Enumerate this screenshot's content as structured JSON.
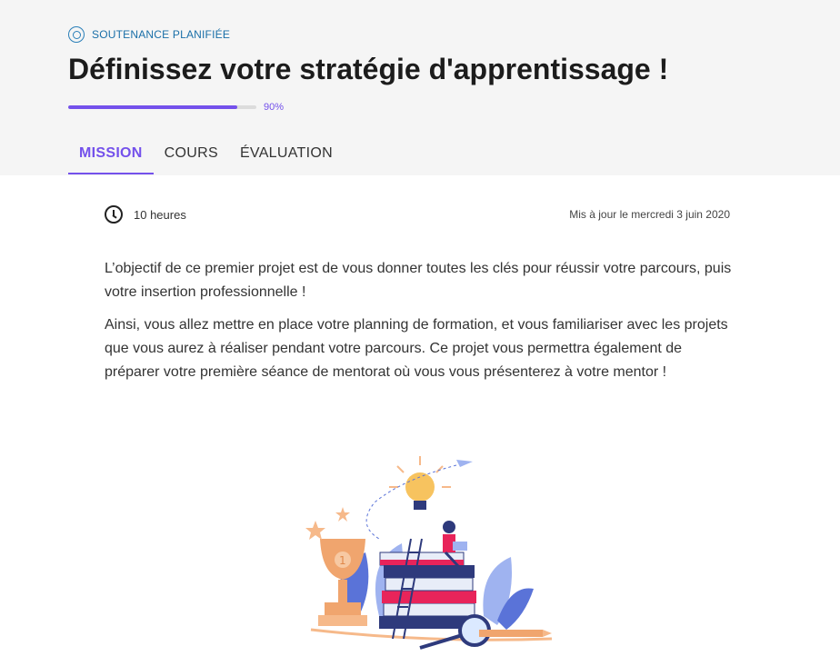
{
  "header": {
    "status_label": "SOUTENANCE PLANIFIÉE",
    "title": "Définissez votre stratégie d'apprentissage !",
    "progress": {
      "value": 0.9,
      "label": "90%"
    }
  },
  "tabs": [
    {
      "label": "MISSION",
      "active": true
    },
    {
      "label": "COURS",
      "active": false
    },
    {
      "label": "ÉVALUATION",
      "active": false
    }
  ],
  "meta": {
    "duration": "10 heures",
    "updated": "Mis à jour le mercredi 3 juin 2020"
  },
  "content": {
    "paragraphs": [
      "L’objectif de ce premier projet est de vous donner toutes les clés pour réussir votre parcours, puis votre insertion professionnelle !",
      "Ainsi, vous allez mettre en place votre planning de formation, et vous familiariser avec les projets que vous aurez à réaliser pendant votre parcours. Ce projet vous permettra également de préparer votre première séance de mentorat où vous vous présenterez à votre mentor !"
    ]
  },
  "colors": {
    "accent": "#7451eb",
    "status_blue": "#1a6fa8",
    "header_bg": "#f5f5f5"
  },
  "icons": {
    "status": "target-icon",
    "duration": "clock-icon"
  }
}
